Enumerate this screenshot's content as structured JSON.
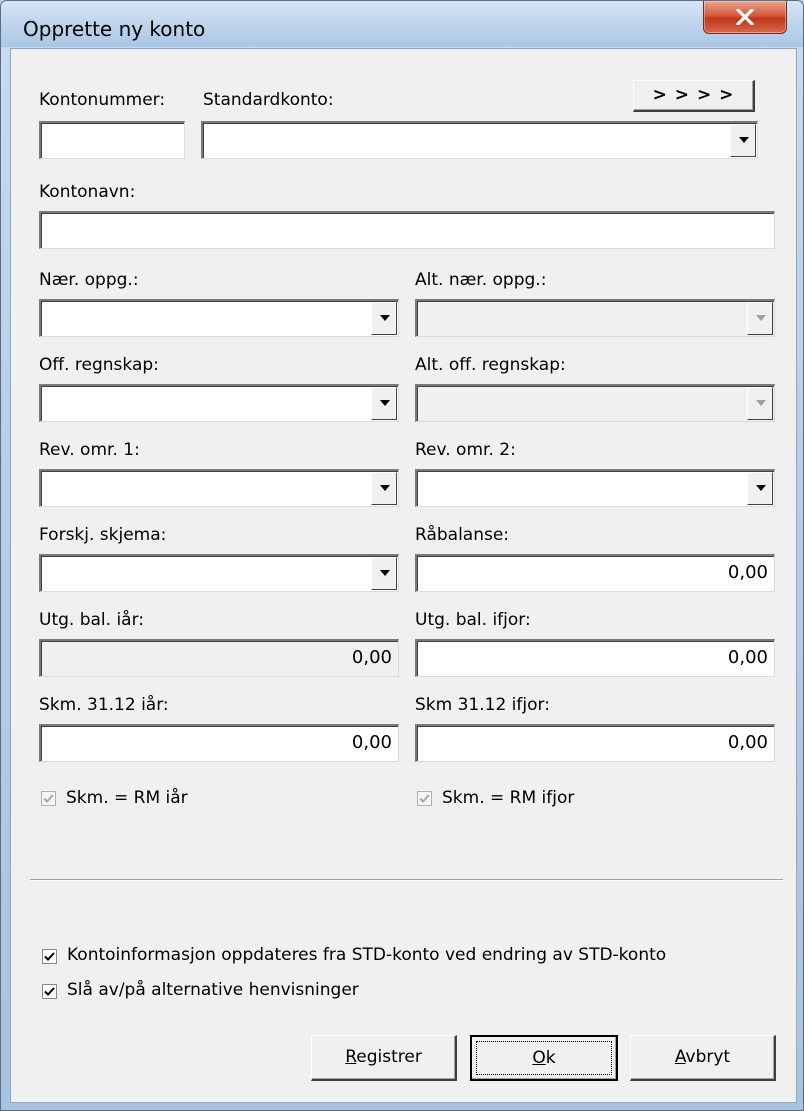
{
  "window": {
    "title": "Opprette ny konto"
  },
  "top": {
    "kontonummer_label": "Kontonummer:",
    "kontonummer_value": "",
    "standardkonto_label": "Standardkonto:",
    "standardkonto_value": "",
    "more_button": "> > > >"
  },
  "kontonavn": {
    "label": "Kontonavn:",
    "value": ""
  },
  "rows": {
    "naer_oppg": {
      "label": "Nær. oppg.:",
      "value": ""
    },
    "alt_naer_oppg": {
      "label": "Alt. nær. oppg.:",
      "value": ""
    },
    "off_regnskap": {
      "label": "Off. regnskap:",
      "value": ""
    },
    "alt_off_regnskap": {
      "label": "Alt. off. regnskap:",
      "value": ""
    },
    "rev_omr_1": {
      "label": "Rev. omr. 1:",
      "value": ""
    },
    "rev_omr_2": {
      "label": "Rev. omr. 2:",
      "value": ""
    },
    "forskj_skjema": {
      "label": "Forskj. skjema:",
      "value": ""
    },
    "rabalanse": {
      "label": "Råbalanse:",
      "value": "0,00"
    },
    "utg_bal_iar": {
      "label": "Utg. bal. iår:",
      "value": "0,00"
    },
    "utg_bal_ifjor": {
      "label": "Utg. bal. ifjor:",
      "value": "0,00"
    },
    "skm_iar": {
      "label": "Skm. 31.12 iår:",
      "value": "0,00"
    },
    "skm_ifjor": {
      "label": "Skm 31.12 ifjor:",
      "value": "0,00"
    }
  },
  "checks": {
    "skm_rm_iar": {
      "label": "Skm. = RM iår",
      "checked": true,
      "enabled": false
    },
    "skm_rm_ifjor": {
      "label": "Skm. = RM ifjor",
      "checked": true,
      "enabled": false
    },
    "kontoinfo": {
      "label": "Kontoinformasjon oppdateres fra STD-konto ved endring av STD-konto",
      "checked": true
    },
    "sla_av_pa": {
      "label": "Slå av/på alternative henvisninger",
      "checked": true
    }
  },
  "buttons": {
    "registrer_accel": "R",
    "registrer_rest": "egistrer",
    "ok_accel": "O",
    "ok_rest": "k",
    "avbryt_accel": "A",
    "avbryt_rest": "vbryt"
  }
}
